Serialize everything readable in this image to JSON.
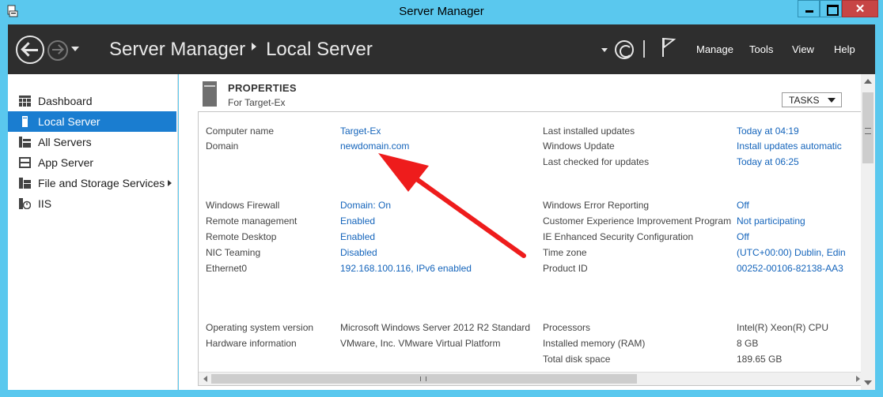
{
  "window": {
    "title": "Server Manager",
    "close_glyph": "✕"
  },
  "header": {
    "breadcrumb_root": "Server Manager",
    "breadcrumb_current": "Local Server",
    "menu": {
      "manage": "Manage",
      "tools": "Tools",
      "view": "View",
      "help": "Help"
    }
  },
  "sidebar": {
    "items": [
      {
        "label": "Dashboard",
        "icon": "dashboard-icon"
      },
      {
        "label": "Local Server",
        "icon": "server-icon",
        "active": true
      },
      {
        "label": "All Servers",
        "icon": "all-servers-icon"
      },
      {
        "label": "App Server",
        "icon": "server-group-icon"
      },
      {
        "label": "File and Storage Services",
        "icon": "file-storage-icon"
      },
      {
        "label": "IIS",
        "icon": "iis-icon"
      }
    ]
  },
  "properties": {
    "title": "PROPERTIES",
    "subtitle": "For Target-Ex",
    "tasks_label": "TASKS",
    "left": {
      "computer_name": {
        "key": "Computer name",
        "value": "Target-Ex"
      },
      "domain": {
        "key": "Domain",
        "value": "newdomain.com"
      },
      "windows_firewall": {
        "key": "Windows Firewall",
        "value": "Domain: On"
      },
      "remote_management": {
        "key": "Remote management",
        "value": "Enabled"
      },
      "remote_desktop": {
        "key": "Remote Desktop",
        "value": "Enabled"
      },
      "nic_teaming": {
        "key": "NIC Teaming",
        "value": "Disabled"
      },
      "ethernet0": {
        "key": "Ethernet0",
        "value": "192.168.100.116, IPv6 enabled"
      },
      "os_version": {
        "key": "Operating system version",
        "value": "Microsoft Windows Server 2012 R2 Standard"
      },
      "hardware": {
        "key": "Hardware information",
        "value": "VMware, Inc. VMware Virtual Platform"
      }
    },
    "right": {
      "last_updates": {
        "key": "Last installed updates",
        "value": "Today at 04:19"
      },
      "windows_update": {
        "key": "Windows Update",
        "value": "Install updates automatic"
      },
      "last_checked": {
        "key": "Last checked for updates",
        "value": "Today at 06:25"
      },
      "error_reporting": {
        "key": "Windows Error Reporting",
        "value": "Off"
      },
      "ceip": {
        "key": "Customer Experience Improvement Program",
        "value": "Not participating"
      },
      "ie_esc": {
        "key": "IE Enhanced Security Configuration",
        "value": "Off"
      },
      "time_zone": {
        "key": "Time zone",
        "value": "(UTC+00:00) Dublin, Edin"
      },
      "product_id": {
        "key": "Product ID",
        "value": "00252-00106-82138-AA3"
      },
      "processors": {
        "key": "Processors",
        "value": "Intel(R) Xeon(R) CPU"
      },
      "memory": {
        "key": "Installed memory (RAM)",
        "value": "8 GB"
      },
      "disk": {
        "key": "Total disk space",
        "value": "189.65 GB"
      }
    }
  },
  "colors": {
    "titlebar": "#5ac8ee",
    "header": "#2e2e2e",
    "active": "#1a7dd0",
    "link": "#1464bb",
    "annotation_arrow": "#ee1c1c"
  }
}
